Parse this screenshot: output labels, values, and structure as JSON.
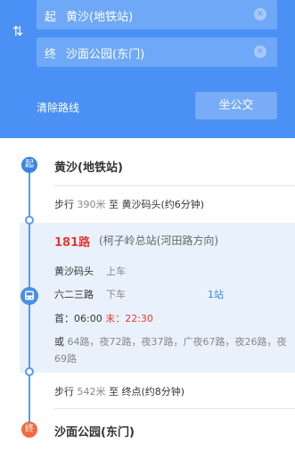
{
  "search": {
    "start_tag": "起",
    "start_value": "黄沙(地铁站)",
    "end_tag": "终",
    "end_value": "沙面公园(东门)",
    "swap_glyph": "⇅",
    "clear_glyph": "×"
  },
  "actions": {
    "clear_route": "清除路线",
    "take_bus": "坐公交"
  },
  "route": {
    "start": {
      "marker": "起",
      "name": "黄沙(地铁站)"
    },
    "walk1": {
      "prefix": "步行",
      "distance": "390米",
      "text": "至 黄沙码头(约6分钟)"
    },
    "bus": {
      "line": "181路",
      "direction": "(柯子岭总站(河田路方向)",
      "board_stop": "黄沙码头",
      "board_action": "上车",
      "alight_stop": "六二三路",
      "alight_action": "下车",
      "stop_count": "1站",
      "first_label": "首：06:00",
      "last_label": "末：22:30",
      "alt_lead": "或",
      "alternatives": "64路，夜72路，夜37路，广夜67路，夜26路，夜69路"
    },
    "walk2": {
      "prefix": "步行",
      "distance": "542米",
      "text": "至 终点(约8分钟)"
    },
    "end": {
      "marker": "终",
      "name": "沙面公园(东门)"
    }
  }
}
